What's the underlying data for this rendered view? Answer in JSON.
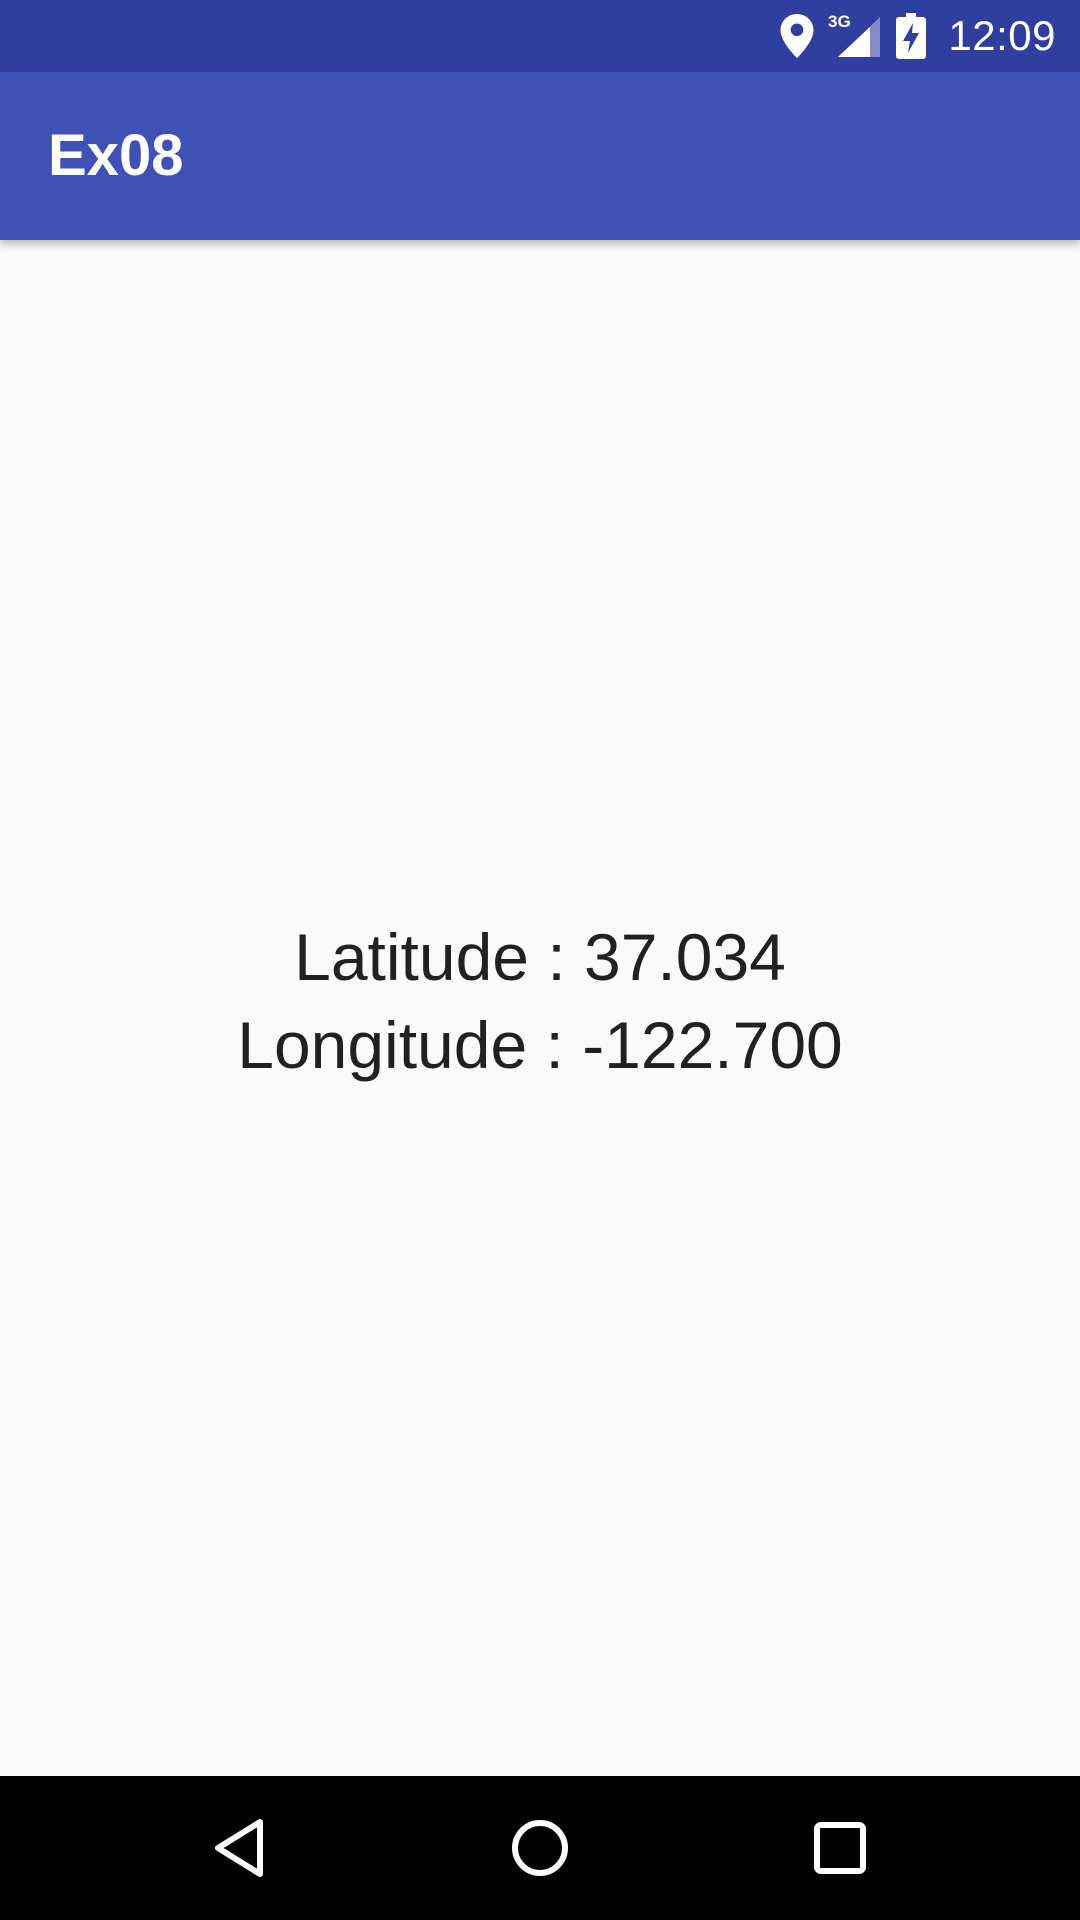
{
  "status_bar": {
    "time": "12:09",
    "network": "3G",
    "icons": [
      "location-icon",
      "signal-3g-icon",
      "battery-charging-icon"
    ],
    "color": "#303f9f"
  },
  "app_bar": {
    "title": "Ex08",
    "color": "#3f51b5"
  },
  "main": {
    "latitude_text": "Latitude : 37.034",
    "longitude_text": "Longitude : -122.700"
  },
  "nav_bar": {
    "buttons": [
      "back-icon",
      "home-icon",
      "recents-icon"
    ]
  }
}
